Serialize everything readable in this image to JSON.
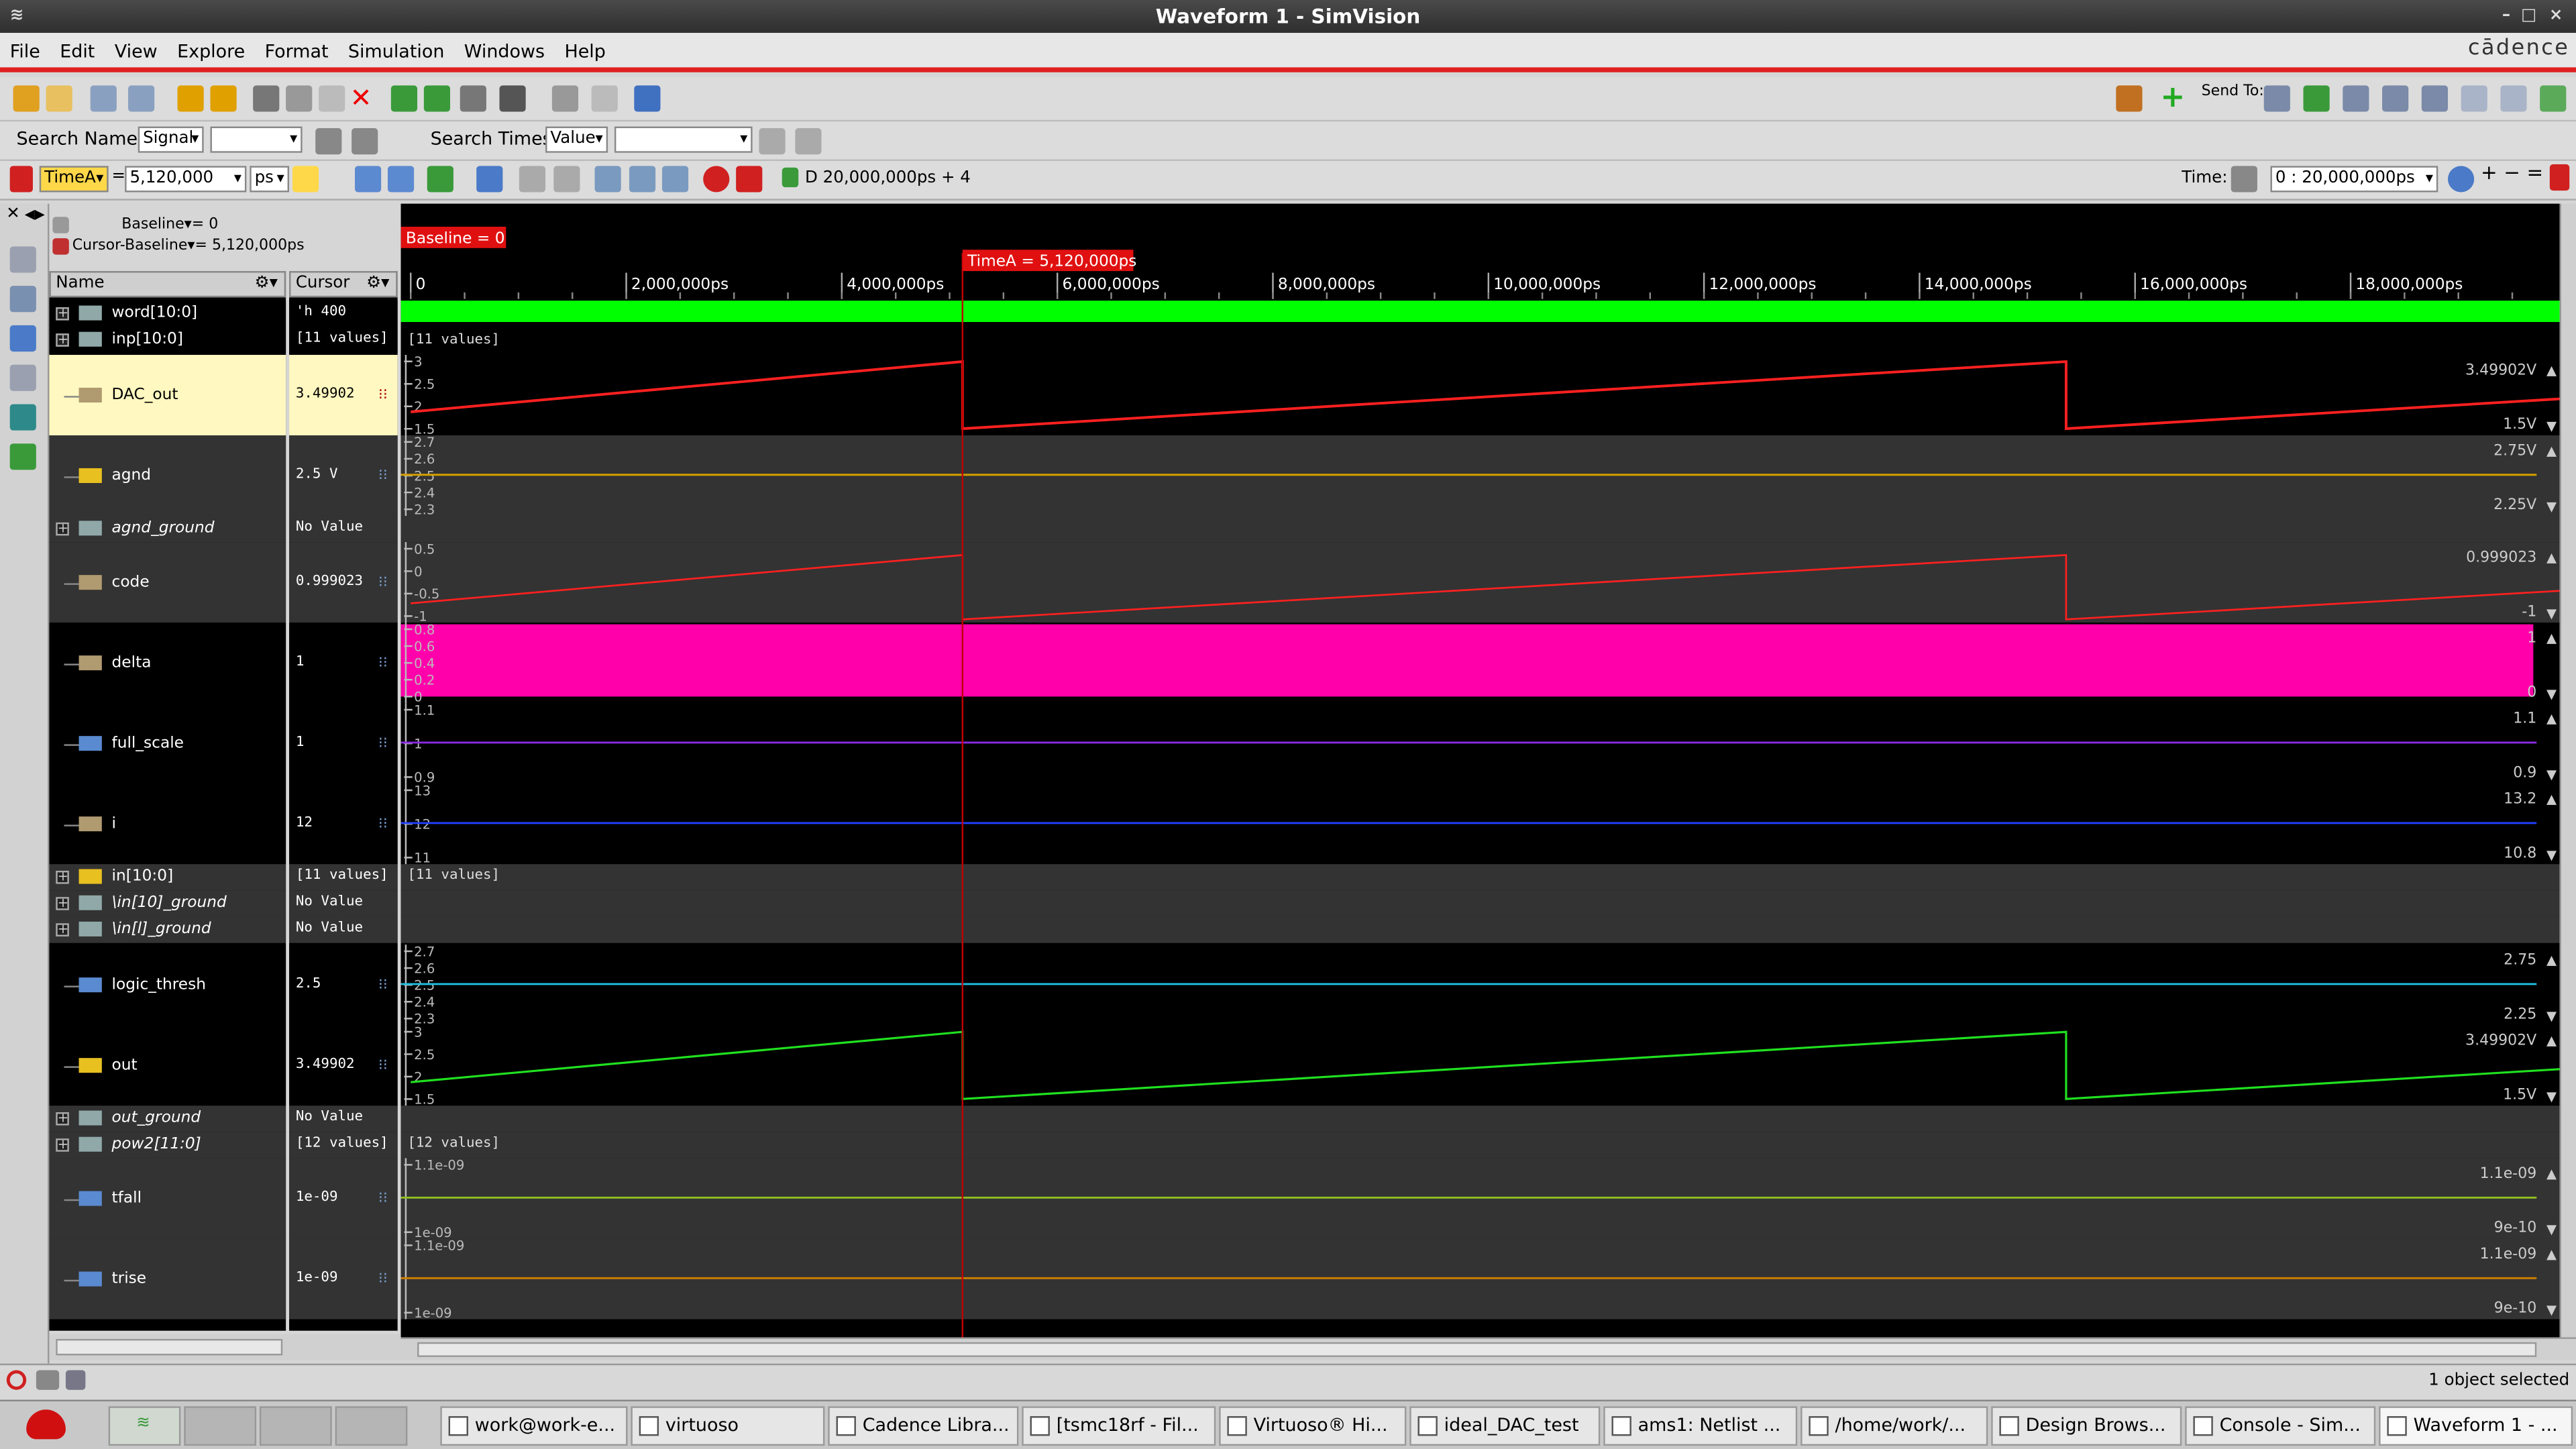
{
  "window": {
    "title": "Waveform 1 - SimVision",
    "brand": "cādence"
  },
  "menu": [
    "File",
    "Edit",
    "View",
    "Explore",
    "Format",
    "Simulation",
    "Windows",
    "Help"
  ],
  "toolbar": {
    "send_to": "Send To:"
  },
  "search": {
    "names_label": "Search Names:",
    "names_type": "Signal",
    "times_label": "Search Times:",
    "times_type": "Value"
  },
  "cursorbar": {
    "cursor": "TimeA",
    "equals": "=",
    "value": "5,120,000",
    "unit": "ps",
    "range": "D 20,000,000ps + 4",
    "time_label": "Time:",
    "time_range": "0 : 20,000,000ps"
  },
  "info": {
    "baseline": "Baseline▾= 0",
    "cursor_baseline": "Cursor-Baseline▾= 5,120,000ps"
  },
  "columns": {
    "name": "Name",
    "cursor": "Cursor"
  },
  "markers": {
    "baseline": "Baseline = 0",
    "timeA": "TimeA = 5,120,000ps"
  },
  "ruler": [
    "0",
    "2,000,000ps",
    "4,000,000ps",
    "6,000,000ps",
    "8,000,000ps",
    "10,000,000ps",
    "12,000,000ps",
    "14,000,000ps",
    "16,000,000ps",
    "18,000,000ps"
  ],
  "signals": [
    {
      "name": "word[10:0]",
      "cursor": "'h 400",
      "icon": "bus",
      "expand": true,
      "italic": false
    },
    {
      "name": "inp[10:0]",
      "cursor": "[11 values]",
      "icon": "bus",
      "expand": true,
      "italic": false
    },
    {
      "name": "DAC_out",
      "cursor": "3.49902",
      "icon": "analog",
      "expand": false,
      "italic": false
    },
    {
      "name": "agnd",
      "cursor": "2.5 V",
      "icon": "port",
      "expand": false,
      "italic": false
    },
    {
      "name": "agnd_ground",
      "cursor": "No Value",
      "icon": "bus",
      "expand": true,
      "italic": true
    },
    {
      "name": "code",
      "cursor": "0.999023",
      "icon": "analog",
      "expand": false,
      "italic": false
    },
    {
      "name": "delta",
      "cursor": "1",
      "icon": "analog",
      "expand": false,
      "italic": false
    },
    {
      "name": "full_scale",
      "cursor": "1",
      "icon": "param",
      "expand": false,
      "italic": false
    },
    {
      "name": "i",
      "cursor": "12",
      "icon": "analog",
      "expand": false,
      "italic": false
    },
    {
      "name": "in[10:0]",
      "cursor": "[11 values]",
      "icon": "port",
      "expand": true,
      "italic": false
    },
    {
      "name": "\\in[10]_ground",
      "cursor": "No Value",
      "icon": "bus",
      "expand": true,
      "italic": true
    },
    {
      "name": "\\in[l]_ground",
      "cursor": "No Value",
      "icon": "bus",
      "expand": true,
      "italic": true
    },
    {
      "name": "logic_thresh",
      "cursor": "2.5",
      "icon": "param",
      "expand": false,
      "italic": false
    },
    {
      "name": "out",
      "cursor": "3.49902",
      "icon": "port",
      "expand": false,
      "italic": false
    },
    {
      "name": "out_ground",
      "cursor": "No Value",
      "icon": "bus",
      "expand": true,
      "italic": true
    },
    {
      "name": "pow2[11:0]",
      "cursor": "[12 values]",
      "icon": "bus",
      "expand": true,
      "italic": true
    },
    {
      "name": "tfall",
      "cursor": "1e-09",
      "icon": "param",
      "expand": false,
      "italic": false
    },
    {
      "name": "trise",
      "cursor": "1e-09",
      "icon": "param",
      "expand": false,
      "italic": false
    }
  ],
  "wave_labels": {
    "inp": "[11 values]",
    "in": "[11 values]",
    "pow2": "[12 values]",
    "dac": {
      "axis": [
        "3",
        "2.5",
        "2",
        "1.5"
      ],
      "max": "3.49902V",
      "min": "1.5V"
    },
    "agnd": {
      "axis": [
        "2.7",
        "2.6",
        "2.5",
        "2.4",
        "2.3"
      ],
      "max": "2.75V",
      "min": "2.25V"
    },
    "code": {
      "axis": [
        "0.5",
        "0",
        "-0.5",
        "-1"
      ],
      "max": "0.999023",
      "min": "-1"
    },
    "delta": {
      "axis": [
        "0.8",
        "0.6",
        "0.4",
        "0.2",
        "0"
      ],
      "max": "1",
      "min": "0"
    },
    "full": {
      "axis": [
        "1.1",
        "1",
        "0.9"
      ],
      "max": "1.1",
      "min": "0.9"
    },
    "i": {
      "axis": [
        "13",
        "12",
        "11"
      ],
      "max": "13.2",
      "min": "10.8"
    },
    "logic": {
      "axis": [
        "2.7",
        "2.6",
        "2.5",
        "2.4",
        "2.3"
      ],
      "max": "2.75",
      "min": "2.25"
    },
    "out": {
      "axis": [
        "3",
        "2.5",
        "2",
        "1.5"
      ],
      "max": "3.49902V",
      "min": "1.5V"
    },
    "tfall": {
      "axis": [
        "1.1e-09",
        "1e-09"
      ],
      "max": "1.1e-09",
      "min": "9e-10"
    },
    "trise": {
      "axis": [
        "1.1e-09",
        "1e-09"
      ],
      "max": "1.1e-09",
      "min": "9e-10"
    }
  },
  "status": "1 object selected",
  "taskbar": [
    "work@work-e...",
    "virtuoso",
    "Cadence Libra...",
    "[tsmc18rf - Fil...",
    "Virtuoso® Hi...",
    "ideal_DAC_test",
    "ams1: Netlist ...",
    "/home/work/...",
    "Design Brows...",
    "Console - Sim...",
    "Waveform 1 - ..."
  ],
  "colors": {
    "accent_red": "#e02020",
    "cursor_line": "#c00000",
    "bus_green": "#00ff00",
    "dac": "#ff2020",
    "agnd": "#d4a000",
    "delta": "#ff00aa",
    "full_scale": "#8a2be2",
    "i_line": "#2040ff",
    "logic": "#20c0e0",
    "out": "#20e020",
    "tfall": "#90c020",
    "trise": "#d08000"
  }
}
